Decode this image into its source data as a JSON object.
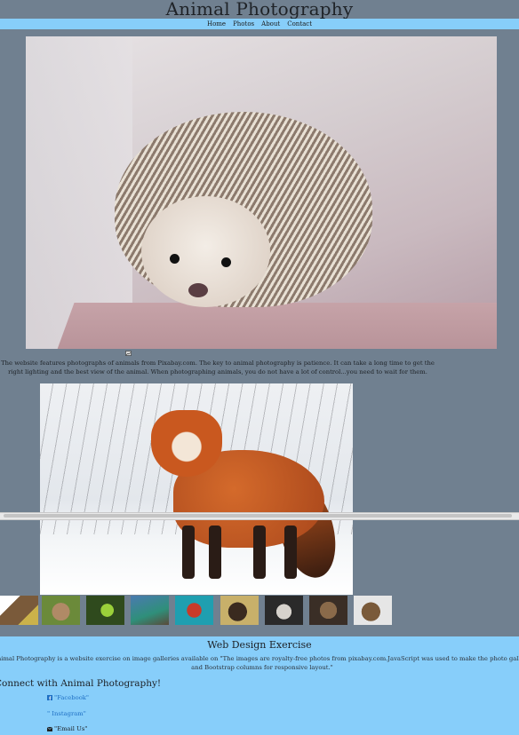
{
  "site": {
    "title": "Animal Photography"
  },
  "nav": {
    "items": [
      "Home",
      "Photos",
      "About",
      "Contact"
    ]
  },
  "intro": {
    "text": "The website features photographs of animals from Pixabay.com. The key to animal photography is patience. It can take a long time to get the right lighting and the best view of the animal. When photographing animals, you do not have a lot of control...you need to wait for them."
  },
  "icons": {
    "broken_image": "broken-image-icon",
    "facebook": "facebook-icon",
    "envelope": "envelope-icon"
  },
  "gallery": {
    "main_photo": "hedgehog",
    "featured_photo": "red fox in snow",
    "thumbnails": [
      "eagle",
      "rabbit",
      "frog",
      "lizard",
      "parrot",
      "bison",
      "deer",
      "owl",
      "ram"
    ]
  },
  "footer": {
    "title": "Web Design Exercise",
    "text": "Animal Photography is a website exercise on image galleries available on \"The images are royalty-free photos from pixabay.com.JavaScript was used to make the photo gallery, and Bootstrap columns for responsive layout.\"",
    "connect_heading": "Connect with Animal Photography!",
    "links": {
      "facebook": "\"Facebook\"",
      "instagram": "\" Instagram\"",
      "email": "\"Email Us\""
    }
  },
  "colors": {
    "page_bg": "#708090",
    "accent": "#87cefa",
    "link": "#1e6fc4"
  }
}
